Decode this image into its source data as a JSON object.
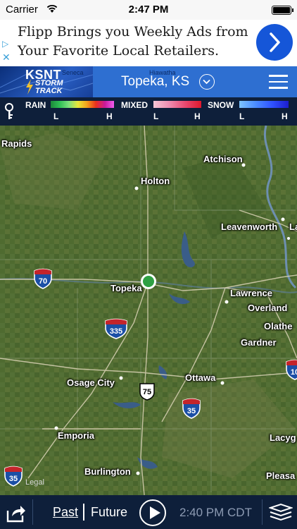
{
  "status_bar": {
    "carrier": "Carrier",
    "time": "2:47 PM"
  },
  "ad": {
    "line1": "Flipp Brings you Weekly Ads from",
    "line2": "Your Favorite Local Retailers."
  },
  "header": {
    "logo_text": "KSNT",
    "logo_sub1": "STORM",
    "logo_sub2": "TRACK",
    "location": "Topeka, KS",
    "map_label_behind_logo_1": "Seneca",
    "map_label_behind_logo_2": "Hiawatha"
  },
  "legend": {
    "rain": "RAIN",
    "mixed": "MIXED",
    "snow": "SNOW",
    "low": "L",
    "high": "H",
    "colors": {
      "rain": [
        "#1c8a3a",
        "#2fbf55",
        "#7be07b",
        "#e8e83a",
        "#f3a21b",
        "#e8301d",
        "#c8199a",
        "#f05ef0"
      ],
      "mixed": [
        "#f6c7d6",
        "#ef8cb0",
        "#e8486f",
        "#e0182c"
      ],
      "snow": [
        "#7ec4ff",
        "#4b8cff",
        "#2f52ff",
        "#1c1ccf"
      ]
    }
  },
  "map": {
    "cities": [
      {
        "name": "Rapids"
      },
      {
        "name": "Atchison"
      },
      {
        "name": "Holton"
      },
      {
        "name": "Leavenworth"
      },
      {
        "name": "La"
      },
      {
        "name": "Topeka"
      },
      {
        "name": "Lawrence"
      },
      {
        "name": "Overland"
      },
      {
        "name": "Olathe"
      },
      {
        "name": "Gardner"
      },
      {
        "name": "Ottawa"
      },
      {
        "name": "Osage City"
      },
      {
        "name": "Emporia"
      },
      {
        "name": "Lacyg"
      },
      {
        "name": "Burlington"
      },
      {
        "name": "Pleasa"
      }
    ],
    "highways": [
      "70",
      "335",
      "75",
      "35",
      "35",
      "10"
    ],
    "legal": "Legal"
  },
  "bottom_bar": {
    "past": "Past",
    "future": "Future",
    "time": "2:40 PM CDT"
  }
}
